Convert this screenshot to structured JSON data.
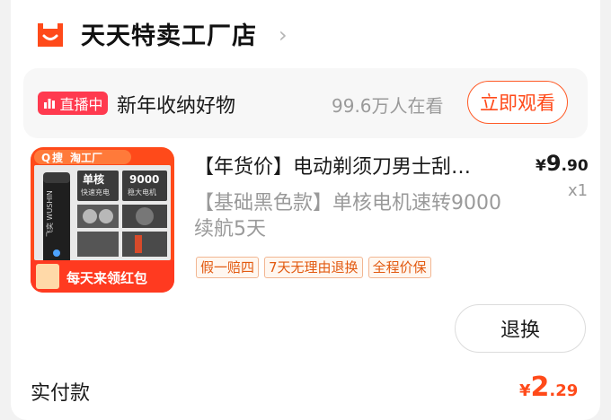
{
  "shop": {
    "name": "天天特卖工厂店",
    "chevron": "›",
    "logo_color": "#ff4a1a"
  },
  "live": {
    "badge": "直播中",
    "title": "新年收纳好物",
    "viewers": "99.6万人在看",
    "watch_button": "立即观看",
    "accent": "#ff3a4f"
  },
  "product": {
    "title": "【年货价】电动剃须刀男士刮…",
    "price_symbol": "¥",
    "price_int": "9",
    "price_dec": ".90",
    "quantity": "x1",
    "sku": "【基础黑色款】单核电机速转9000续航5天",
    "tags": [
      "假一赔四",
      "7天无理由退换",
      "全程价保"
    ],
    "image": {
      "search_label": "搜",
      "platform_label": "淘工厂",
      "core_label": "单核",
      "core_sub": "快速充电",
      "rpm_label": "9000",
      "rpm_sub": "稳大电机",
      "brand_text": "飞奕 WUSHIN",
      "footer": "每天来领红包"
    }
  },
  "actions": {
    "refund_button": "退换"
  },
  "payment": {
    "label": "实付款",
    "symbol": "¥",
    "amount_int": "2",
    "amount_dec": ".29",
    "color": "#ff4a1a"
  }
}
